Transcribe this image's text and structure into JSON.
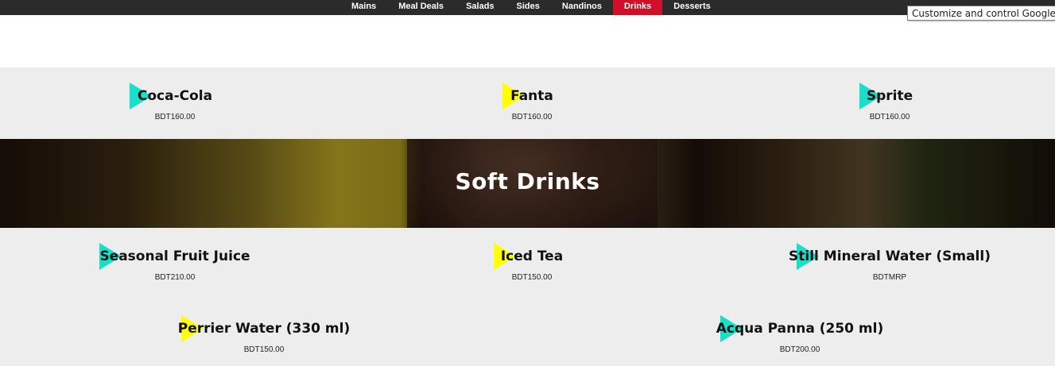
{
  "nav": {
    "items": [
      "Mains",
      "Meal Deals",
      "Salads",
      "Sides",
      "Nandinos",
      "Drinks",
      "Desserts"
    ],
    "active_index": 5,
    "active_color": "#d0102a"
  },
  "tooltip": "Customize and control Google Chrome",
  "section": {
    "title": "Soft Drinks"
  },
  "colors": {
    "triangle_teal": "#18e0c8",
    "triangle_yellow": "#ffff00"
  },
  "menu": {
    "top": [
      {
        "name": "Coca-Cola",
        "price": "BDT160.00",
        "icon": "play-triangle-teal"
      },
      {
        "name": "Fanta",
        "price": "BDT160.00",
        "icon": "play-triangle-yellow"
      },
      {
        "name": "Sprite",
        "price": "BDT160.00",
        "icon": "play-triangle-teal"
      }
    ],
    "soft_drinks": [
      {
        "name": "Seasonal Fruit Juice",
        "price": "BDT210.00",
        "icon": "play-triangle-teal"
      },
      {
        "name": "Iced Tea",
        "price": "BDT150.00",
        "icon": "play-triangle-yellow"
      },
      {
        "name": "Still Mineral Water (Small)",
        "price": "BDTMRP",
        "icon": "play-triangle-teal"
      },
      {
        "name": "Perrier Water (330 ml)",
        "price": "BDT150.00",
        "icon": "play-triangle-yellow"
      },
      {
        "name": "Acqua Panna (250 ml)",
        "price": "BDT200.00",
        "icon": "play-triangle-teal"
      }
    ]
  }
}
